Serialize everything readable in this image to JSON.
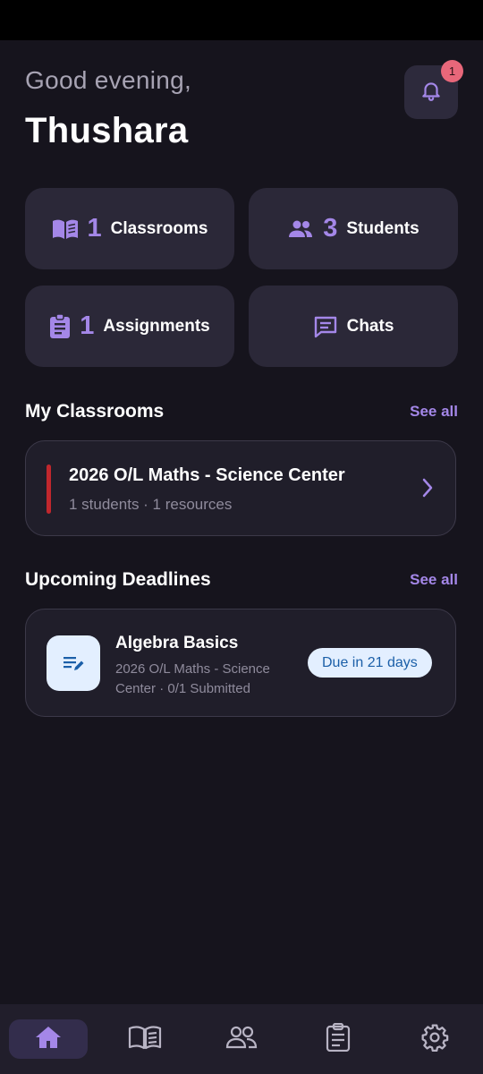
{
  "header": {
    "greeting": "Good evening,",
    "user_name": "Thushara",
    "notification_count": "1"
  },
  "stats": [
    {
      "count": "1",
      "label": "Classrooms",
      "icon": "book-open-icon"
    },
    {
      "count": "3",
      "label": "Students",
      "icon": "people-icon"
    },
    {
      "count": "1",
      "label": "Assignments",
      "icon": "clipboard-icon"
    },
    {
      "count": "",
      "label": "Chats",
      "icon": "chat-icon"
    }
  ],
  "classrooms": {
    "title": "My Classrooms",
    "see_all": "See all",
    "items": [
      {
        "name": "2026 O/L Maths - Science Center",
        "meta": "1 students · 1 resources",
        "accent_color": "#c0272d"
      }
    ]
  },
  "deadlines": {
    "title": "Upcoming Deadlines",
    "see_all": "See all",
    "items": [
      {
        "title": "Algebra Basics",
        "meta": "2026 O/L Maths - Science Center · 0/1 Submitted",
        "due": "Due in 21 days"
      }
    ]
  },
  "bottom_nav": [
    {
      "icon": "home-icon",
      "active": true
    },
    {
      "icon": "book-icon",
      "active": false
    },
    {
      "icon": "people-icon",
      "active": false
    },
    {
      "icon": "clipboard-icon",
      "active": false
    },
    {
      "icon": "settings-icon",
      "active": false
    }
  ],
  "colors": {
    "background": "#16141d",
    "card": "#2b2838",
    "accent": "#a487e8",
    "badge": "#e8677a",
    "due_badge_bg": "#e3efff",
    "due_badge_text": "#1b5fa8"
  }
}
